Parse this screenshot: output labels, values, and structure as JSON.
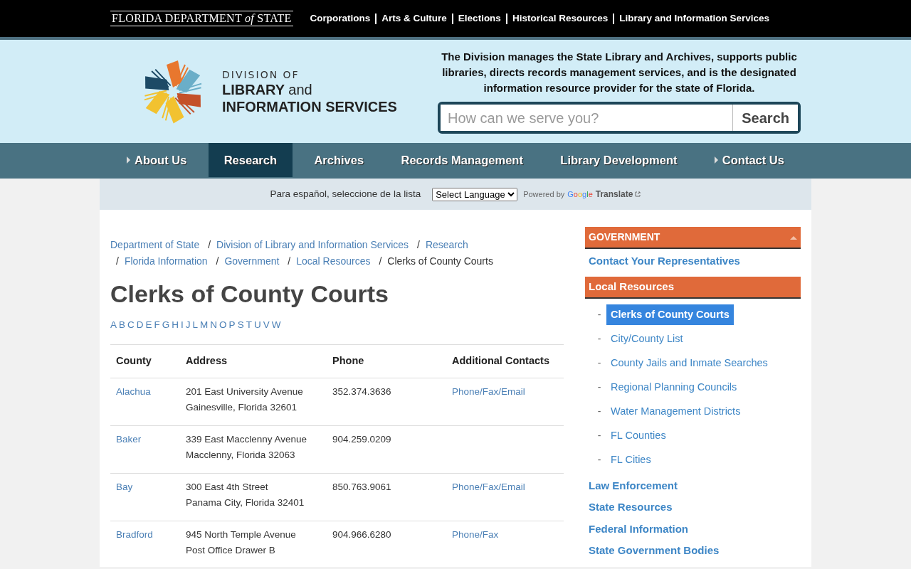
{
  "top_bar": {
    "agency_logo": "FLORIDA DEPARTMENT *of* STATE",
    "links": [
      "Corporations",
      "Arts & Culture",
      "Elections",
      "Historical Resources",
      "Library and Information Services"
    ]
  },
  "header": {
    "logo": {
      "line_1": "DIVISION OF",
      "line_2": "LIBRARY",
      "line_2_suffix": "and",
      "line_3": "INFORMATION SERVICES"
    },
    "mission": "The Division manages the State Library and Archives, supports public libraries, directs records management services, and is the designated information resource provider for the state of Florida.",
    "search": {
      "placeholder": "How can we serve you?",
      "button": "Search"
    }
  },
  "main_nav": [
    {
      "label": "About Us",
      "submenu": true,
      "selected": false
    },
    {
      "label": "Research",
      "submenu": false,
      "selected": true
    },
    {
      "label": "Archives",
      "submenu": false,
      "selected": false
    },
    {
      "label": "Records Management",
      "submenu": false,
      "selected": false
    },
    {
      "label": "Library Development",
      "submenu": false,
      "selected": false
    },
    {
      "label": "Contact Us",
      "submenu": true,
      "selected": false
    }
  ],
  "language_bar": {
    "label": "Para español, seleccione de la lista",
    "select_value": "Select Language",
    "powered_by": "Powered by",
    "google": "Google",
    "translate": "Translate"
  },
  "breadcrumb_separator": "/",
  "breadcrumb": [
    "Department of State",
    "Division of Library and Information Services",
    "Research",
    "Florida Information",
    "Government",
    "Local Resources",
    "Clerks of County Courts"
  ],
  "title": "Clerks of County Courts",
  "alphabet": [
    "A",
    "B",
    "C",
    "D",
    "E",
    "F",
    "G",
    "H",
    "I",
    "J",
    "L",
    "M",
    "N",
    "O",
    "P",
    "S",
    "T",
    "U",
    "V",
    "W"
  ],
  "table": {
    "columns": [
      "County",
      "Address",
      "Phone",
      "Additional Contacts"
    ],
    "rows": [
      {
        "county": "Alachua",
        "address": [
          "201 East University Avenue",
          "Gainesville, Florida 32601"
        ],
        "phone": "352.374.3636",
        "contacts": "Phone/Fax/Email"
      },
      {
        "county": "Baker",
        "address": [
          "339 East Macclenny Avenue",
          "Macclenny, Florida 32063"
        ],
        "phone": "904.259.0209"
      },
      {
        "county": "Bay",
        "address": [
          "300 East 4th Street",
          "Panama City, Florida 32401"
        ],
        "phone": "850.763.9061",
        "contacts": "Phone/Fax/Email"
      },
      {
        "county": "Bradford",
        "address": [
          "945 North Temple Avenue",
          "Post Office Drawer B"
        ],
        "phone": "904.966.6280",
        "contacts": "Phone/Fax"
      }
    ]
  },
  "sidebar": {
    "heading": "GOVERNMENT",
    "expanded": true,
    "items": [
      {
        "kind": "link",
        "label": "Contact Your Representatives"
      },
      {
        "kind": "section",
        "label": "Local Resources",
        "child_marker": "-",
        "children": [
          {
            "label": "Clerks of County Courts",
            "selected": true
          },
          {
            "label": "City/County List",
            "selected": false
          },
          {
            "label": "County Jails and Inmate Searches",
            "selected": false
          },
          {
            "label": "Regional Planning Councils",
            "selected": false
          },
          {
            "label": "Water Management Districts",
            "selected": false
          },
          {
            "label": "FL Counties",
            "selected": false
          },
          {
            "label": "FL Cities",
            "selected": false
          }
        ]
      },
      {
        "kind": "link",
        "label": "Law Enforcement"
      },
      {
        "kind": "link",
        "label": "State Resources"
      },
      {
        "kind": "link",
        "label": "Federal Information"
      },
      {
        "kind": "link",
        "label": "State Government Bodies"
      }
    ]
  }
}
